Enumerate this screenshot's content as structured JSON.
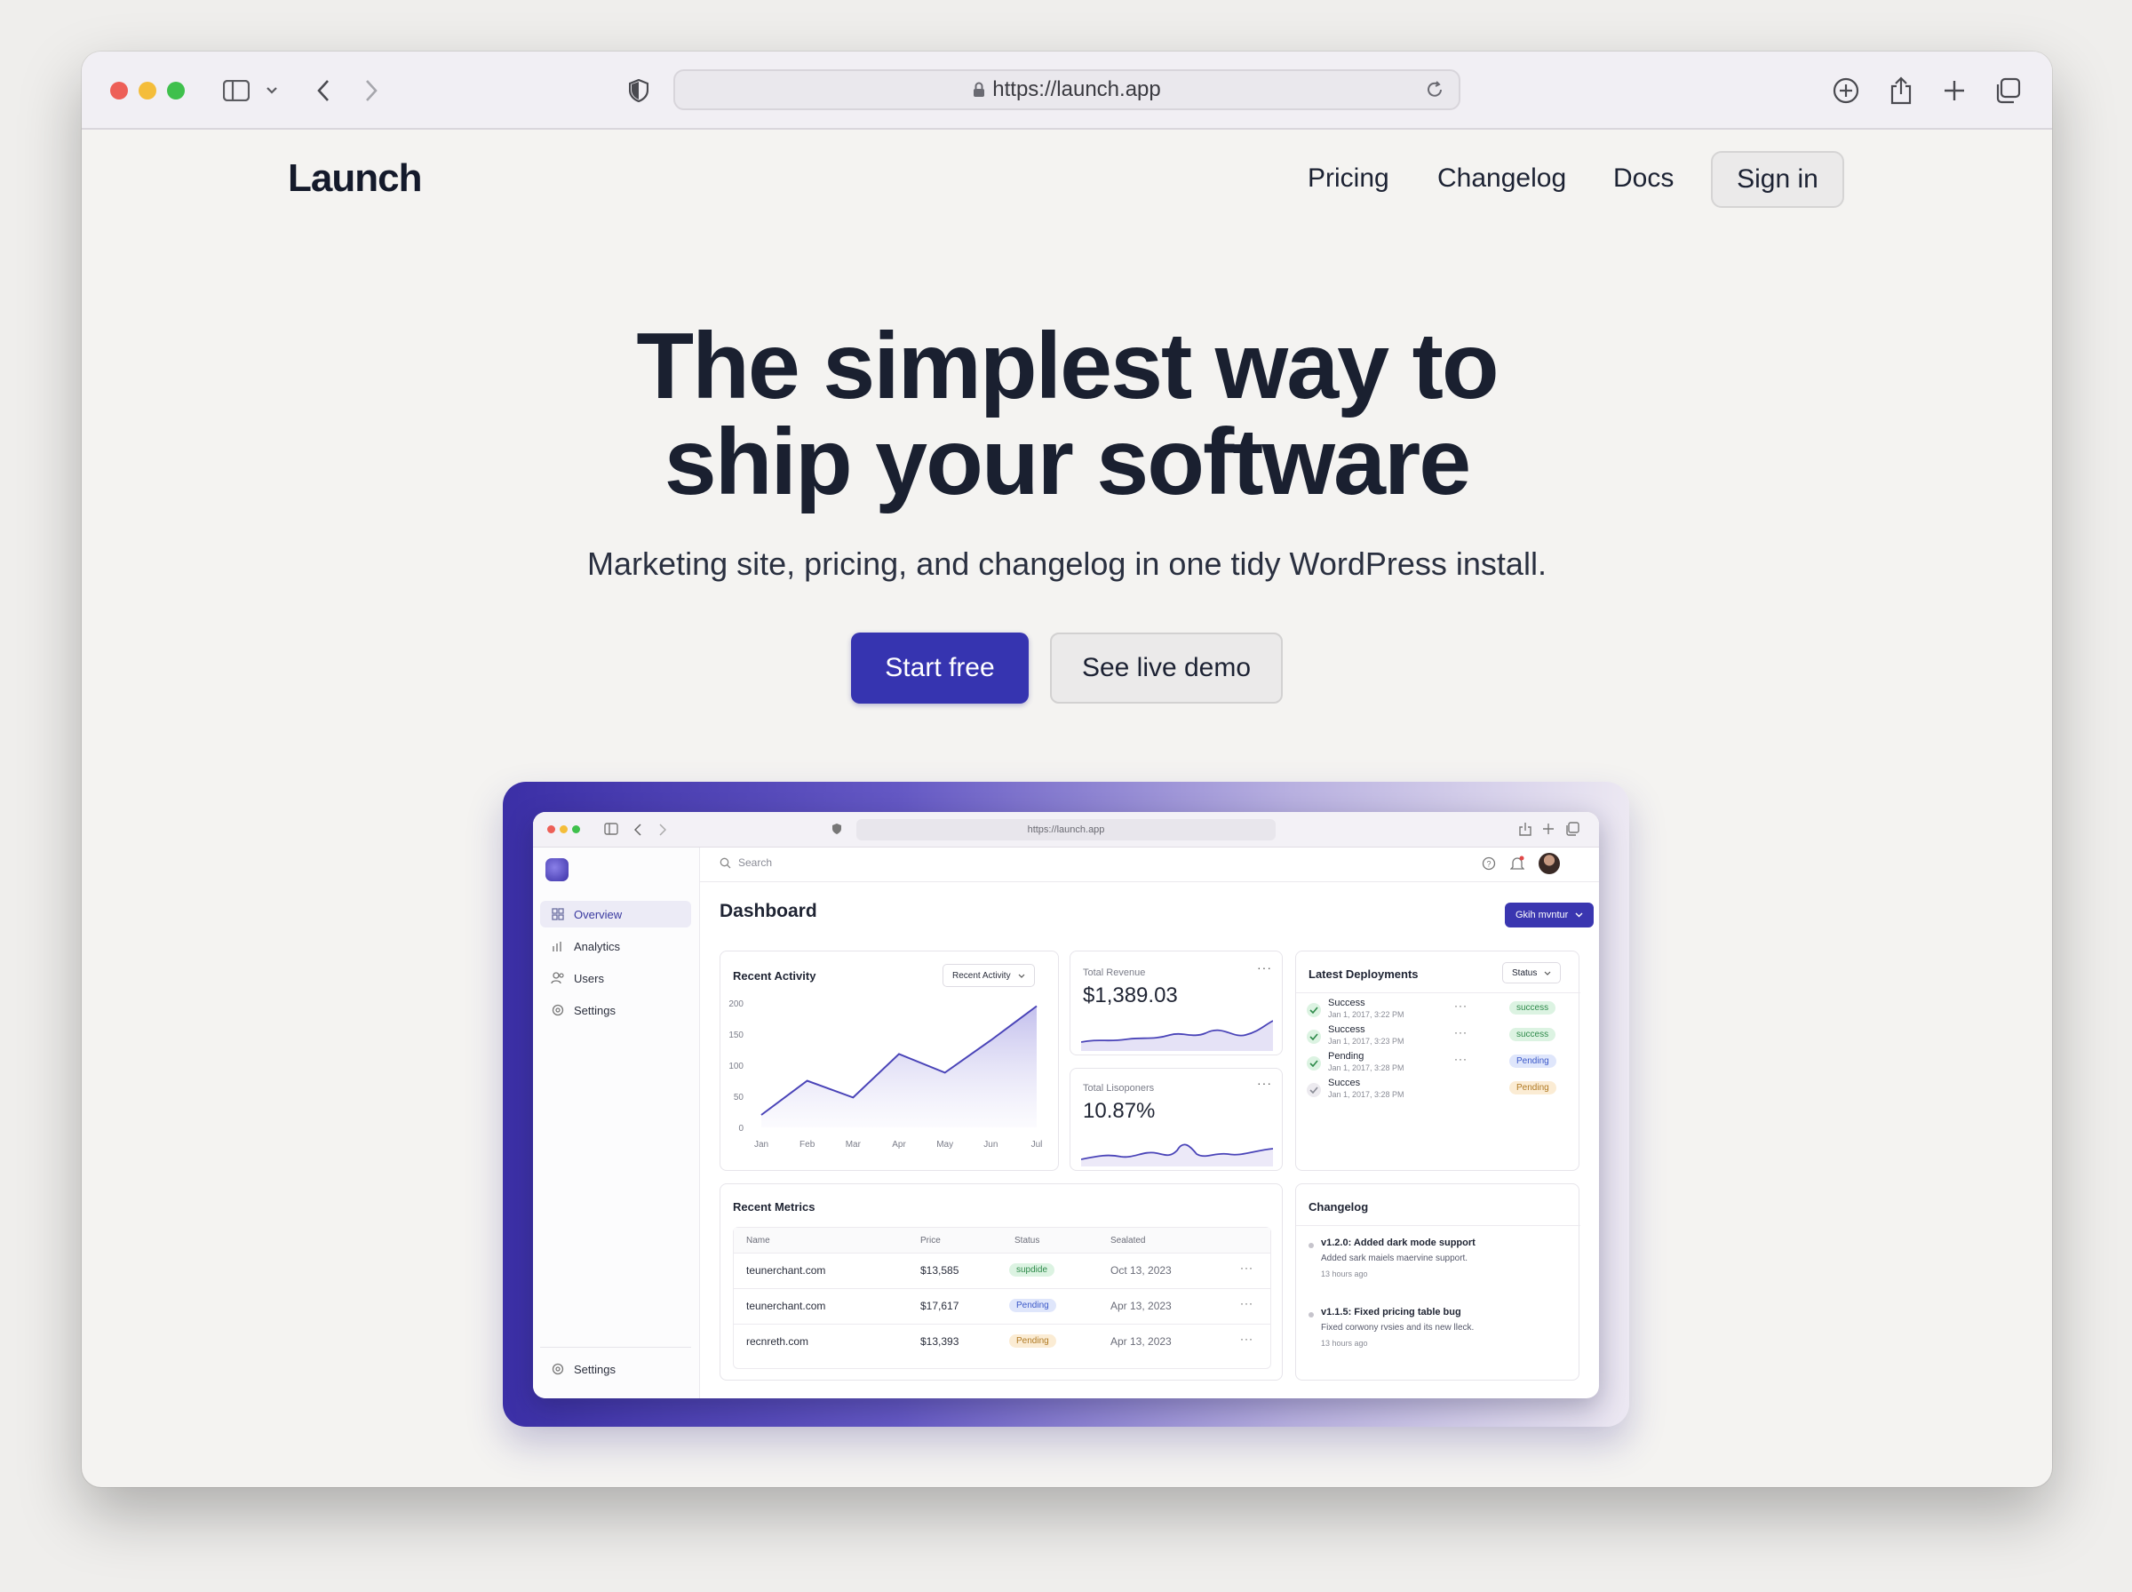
{
  "browser": {
    "url": "https://launch.app"
  },
  "site": {
    "logo": "Launch",
    "nav": [
      "Pricing",
      "Changelog",
      "Docs"
    ],
    "sign_in": "Sign in",
    "hero_line1": "The simplest way to",
    "hero_line2": "ship your software",
    "hero_sub": "Marketing site, pricing, and changelog in one tidy WordPress install.",
    "cta_primary": "Start free",
    "cta_secondary": "See live demo"
  },
  "mock": {
    "url": "https://launch.app",
    "search_placeholder": "Search",
    "sidebar": [
      "Overview",
      "Analytics",
      "Users",
      "Settings"
    ],
    "sidebar_footer": "Settings",
    "page_title": "Dashboard",
    "header_button": "Gkih mvntur",
    "recent_activity": {
      "title": "Recent Activity",
      "dropdown": "Recent Activity"
    },
    "total_revenue": {
      "label": "Total Revenue",
      "value": "$1,389.03"
    },
    "total_lisoponers": {
      "label": "Total Lisoponers",
      "value": "10.87%"
    },
    "deployments": {
      "title": "Latest Deployments",
      "filter": "Status",
      "items": [
        {
          "name": "Success",
          "time": "Jan 1, 2017, 3:22 PM",
          "badge": "success"
        },
        {
          "name": "Success",
          "time": "Jan 1, 2017, 3:23 PM",
          "badge": "success"
        },
        {
          "name": "Pending",
          "time": "Jan 1, 2017, 3:28 PM",
          "badge": "Pending"
        },
        {
          "name": "Succes",
          "time": "Jan 1, 2017, 3:28 PM",
          "badge": "Pending"
        }
      ]
    },
    "metrics": {
      "title": "Recent Metrics",
      "columns": [
        "Name",
        "Price",
        "Status",
        "Sealated"
      ],
      "rows": [
        {
          "name": "teunerchant.com",
          "price": "$13,585",
          "status": "supdide",
          "date": "Oct 13, 2023"
        },
        {
          "name": "teunerchant.com",
          "price": "$17,617",
          "status": "Pending",
          "date": "Apr 13, 2023"
        },
        {
          "name": "recnreth.com",
          "price": "$13,393",
          "status": "Pending",
          "date": "Apr 13, 2023"
        }
      ]
    },
    "changelog": {
      "title": "Changelog",
      "items": [
        {
          "title": "v1.2.0: Added dark mode support",
          "desc": "Added sark maiels maervine support.",
          "time": "13 hours ago"
        },
        {
          "title": "v1.1.5: Fixed pricing table bug",
          "desc": "Fixed corwony rvsies and its new lleck.",
          "time": "13 hours ago"
        }
      ]
    }
  },
  "chart_data": {
    "type": "area",
    "title": "Recent Activity",
    "categories": [
      "Jan",
      "Feb",
      "Mar",
      "Apr",
      "May",
      "Jun",
      "Jul"
    ],
    "values": [
      20,
      75,
      48,
      118,
      88,
      140,
      195
    ],
    "yticks": [
      0,
      50,
      100,
      150,
      200
    ],
    "ylim": [
      0,
      200
    ],
    "color": "#4a44b8"
  }
}
